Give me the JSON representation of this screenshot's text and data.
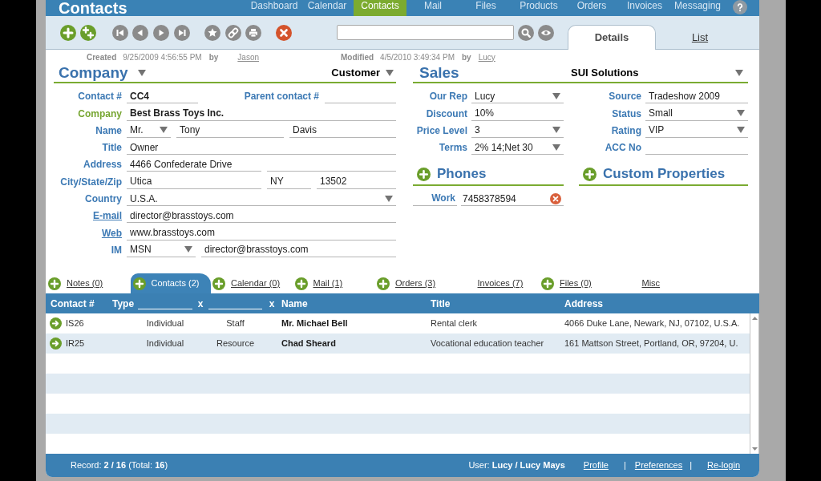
{
  "header": {
    "title": "Contacts",
    "nav": [
      {
        "label": "Dashboard",
        "selected": false
      },
      {
        "label": "Calendar",
        "selected": false
      },
      {
        "label": "Contacts",
        "selected": true
      },
      {
        "label": "Mail",
        "selected": false
      },
      {
        "label": "Files",
        "selected": false
      },
      {
        "label": "Products",
        "selected": false
      },
      {
        "label": "Orders",
        "selected": false
      },
      {
        "label": "Invoices",
        "selected": false
      },
      {
        "label": "Messaging",
        "selected": false
      }
    ]
  },
  "view_tabs": [
    {
      "label": "Details",
      "selected": true
    },
    {
      "label": "List",
      "selected": false
    }
  ],
  "record_info": {
    "created": {
      "label": "Created",
      "value": "9/25/2009 4:56:55 PM",
      "by": "by",
      "user": "Jason"
    },
    "modified": {
      "label": "Modified",
      "value": "4/5/2010 3:49:34 PM",
      "by": "by",
      "user": "Lucy"
    }
  },
  "company": {
    "heading": "Company",
    "category": "Customer",
    "rows": [
      {
        "label": "Contact #",
        "kind": "plain",
        "inputs": [
          {
            "kind": "text",
            "value": "CC4",
            "bold": true
          },
          {
            "kind": "label",
            "value": "Parent contact #"
          },
          {
            "kind": "text"
          }
        ]
      },
      {
        "label": "Company",
        "kind": "accent",
        "inputs": [
          {
            "kind": "text",
            "value": "Best Brass Toys Inc.",
            "bold": true
          }
        ]
      },
      {
        "label": "Name",
        "kind": "plain",
        "inputs": [
          {
            "kind": "select",
            "value": "Mr."
          },
          {
            "kind": "text",
            "value": "Tony"
          },
          {
            "kind": "text",
            "value": "Davis"
          }
        ]
      },
      {
        "label": "Title",
        "kind": "plain",
        "inputs": [
          {
            "kind": "text",
            "value": "Owner"
          }
        ]
      },
      {
        "label": "Address",
        "kind": "plain",
        "inputs": [
          {
            "kind": "text",
            "value": "4466 Confederate Drive"
          },
          {
            "kind": "text"
          }
        ]
      },
      {
        "label": "City/State/Zip",
        "kind": "plain",
        "inputs": [
          {
            "kind": "text",
            "value": "Utica"
          },
          {
            "kind": "text",
            "value": "NY"
          },
          {
            "kind": "text",
            "value": "13502"
          }
        ]
      },
      {
        "label": "Country",
        "kind": "plain",
        "inputs": [
          {
            "kind": "select",
            "value": "U.S.A."
          }
        ]
      },
      {
        "label": "E-mail",
        "kind": "link",
        "inputs": [
          {
            "kind": "text",
            "value": "director@brasstoys.com"
          }
        ]
      },
      {
        "label": "Web",
        "kind": "link",
        "inputs": [
          {
            "kind": "text",
            "value": "www.brasstoys.com"
          }
        ]
      },
      {
        "label": "IM",
        "kind": "plain",
        "inputs": [
          {
            "kind": "select",
            "value": "MSN"
          },
          {
            "kind": "text",
            "value": "director@brasstoys.com"
          }
        ]
      }
    ]
  },
  "sales": {
    "heading": "Sales",
    "company": "SUI Solutions",
    "left": [
      {
        "label": "Our Rep",
        "kind": "select",
        "value": "Lucy"
      },
      {
        "label": "Discount",
        "kind": "text",
        "value": "10%"
      },
      {
        "label": "Price Level",
        "kind": "select",
        "value": "3"
      },
      {
        "label": "Terms",
        "kind": "select",
        "value": "2% 14;Net 30"
      }
    ],
    "right": [
      {
        "label": "Source",
        "kind": "text",
        "value": "Tradeshow 2009"
      },
      {
        "label": "Status",
        "kind": "select",
        "value": "Small"
      },
      {
        "label": "Rating",
        "kind": "select",
        "value": "VIP"
      },
      {
        "label": "ACC No",
        "kind": "text"
      }
    ]
  },
  "phones": {
    "heading": "Phones",
    "items": [
      {
        "label": "Work",
        "value": "7458378594"
      }
    ]
  },
  "custom_properties": {
    "heading": "Custom Properties"
  },
  "related_tabs": [
    {
      "label": "Notes (0)",
      "selected": false,
      "add_button": true
    },
    {
      "label": "Contacts (2)",
      "selected": true,
      "add_button": true
    },
    {
      "label": "Calendar (0)",
      "selected": false,
      "add_button": true
    },
    {
      "label": "Mail (1)",
      "selected": false,
      "add_button": true
    },
    {
      "label": "Orders (3)",
      "selected": false,
      "add_button": true
    },
    {
      "label": "Invoices (7)",
      "selected": false,
      "add_button": false
    },
    {
      "label": "Files (0)",
      "selected": false,
      "add_button": true
    },
    {
      "label": "Misc",
      "selected": false,
      "add_button": false
    }
  ],
  "table": {
    "columns": [
      {
        "kind": "text",
        "label": "Contact #"
      },
      {
        "kind": "text",
        "label": "Type"
      },
      {
        "kind": "filter"
      },
      {
        "kind": "clear",
        "label": "x"
      },
      {
        "kind": "filter"
      },
      {
        "kind": "clear",
        "label": "x"
      },
      {
        "kind": "text",
        "label": "Name"
      },
      {
        "kind": "text",
        "label": "Title"
      },
      {
        "kind": "text",
        "label": "Address"
      }
    ],
    "rows": [
      {
        "cells": [
          "IS26",
          "Individual",
          "Staff",
          "Mr. Michael Bell",
          "Rental clerk",
          "4066 Duke Lane, Newark, NJ, 07102, U.S.A."
        ]
      },
      {
        "cells": [
          "IR25",
          "Individual",
          "Resource",
          "Chad Sheard",
          "Vocational education teacher",
          "161 Mattson Street, Portland, OR, 97204, U."
        ]
      }
    ]
  },
  "status_bar": {
    "record": "Record: **2 / 16** (Total: **16**)",
    "user": "User: **Lucy / Lucy Mays**",
    "links": [
      {
        "label": "Profile"
      },
      {
        "separator": "|",
        "label": "Preferences"
      },
      {
        "separator": "|",
        "label": "Re-login"
      }
    ]
  }
}
